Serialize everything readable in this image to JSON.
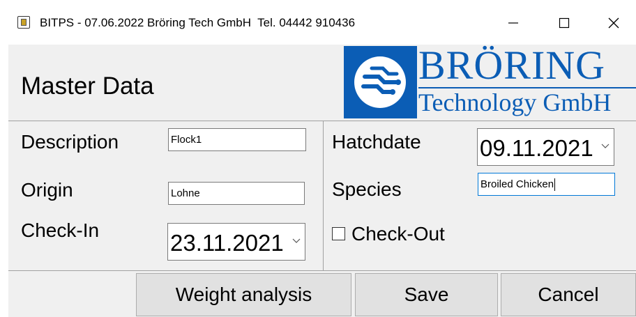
{
  "window": {
    "title": "BITPS - 07.06.2022 Bröring Tech GmbH  Tel. 04442 910436",
    "controls": [
      "minimize",
      "maximize",
      "close"
    ]
  },
  "form": {
    "heading": "Master Data"
  },
  "logo": {
    "name": "BRÖRING",
    "subtitle": "Technology GmbH",
    "brand_color": "#0b5db5"
  },
  "fields": {
    "description": {
      "label": "Description",
      "value": "Flock1"
    },
    "origin": {
      "label": "Origin",
      "value": "Lohne"
    },
    "check_in": {
      "label": "Check-In",
      "value": "23.11.2021"
    },
    "hatchdate": {
      "label": "Hatchdate",
      "value": "09.11.2021"
    },
    "species": {
      "label": "Species",
      "value": "Broiled Chicken"
    },
    "check_out": {
      "label": "Check-Out",
      "checked": false
    }
  },
  "buttons": {
    "weight_analysis": "Weight analysis",
    "save": "Save",
    "cancel": "Cancel"
  },
  "icons": {
    "app": "app-icon",
    "minimize": "minimize-icon",
    "maximize": "maximize-icon",
    "close": "close-icon",
    "dropdown": "chevron-down-icon"
  }
}
